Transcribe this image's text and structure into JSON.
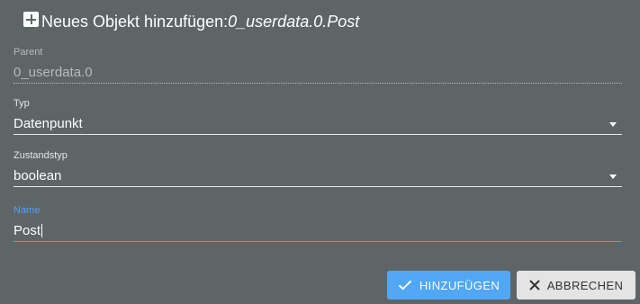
{
  "dialog": {
    "title_prefix": "Neues Objekt hinzufügen:",
    "title_path": "0_userdata.0.Post",
    "icon": "plus-box-icon"
  },
  "fields": {
    "parent": {
      "label": "Parent",
      "value": "0_userdata.0"
    },
    "typ": {
      "label": "Typ",
      "value": "Datenpunkt"
    },
    "zustandstyp": {
      "label": "Zustandstyp",
      "value": "boolean"
    },
    "name": {
      "label": "Name",
      "value": "Post"
    }
  },
  "buttons": {
    "add": {
      "label": "HINZUFÜGEN",
      "icon": "check-icon"
    },
    "cancel": {
      "label": "ABBRECHEN",
      "icon": "close-icon"
    }
  },
  "colors": {
    "background": "#5e6567",
    "accent": "#4ea1f3",
    "add_button": "#51a7f3",
    "cancel_button": "#e4e4e4"
  }
}
